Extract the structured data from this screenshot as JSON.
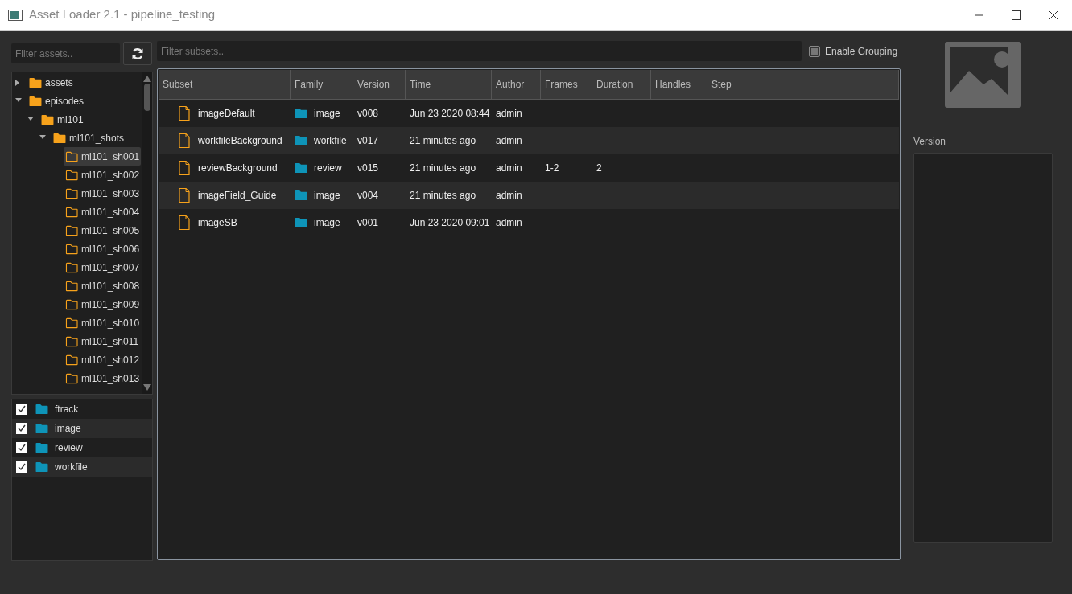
{
  "window": {
    "title": "Asset Loader 2.1 - pipeline_testing"
  },
  "asset_filter": {
    "placeholder": "Filter assets.."
  },
  "asset_tree": [
    {
      "label": "assets",
      "kind": "group",
      "expanded": false,
      "selected": false
    },
    {
      "label": "episodes",
      "kind": "group",
      "expanded": true,
      "selected": false,
      "children": [
        {
          "label": "ml101",
          "kind": "group",
          "expanded": true,
          "selected": false,
          "children": [
            {
              "label": "ml101_shots",
              "kind": "group",
              "expanded": true,
              "selected": false,
              "children": [
                {
                  "label": "ml101_sh001",
                  "kind": "leaf",
                  "selected": true
                },
                {
                  "label": "ml101_sh002",
                  "kind": "leaf",
                  "selected": false
                },
                {
                  "label": "ml101_sh003",
                  "kind": "leaf",
                  "selected": false
                },
                {
                  "label": "ml101_sh004",
                  "kind": "leaf",
                  "selected": false
                },
                {
                  "label": "ml101_sh005",
                  "kind": "leaf",
                  "selected": false
                },
                {
                  "label": "ml101_sh006",
                  "kind": "leaf",
                  "selected": false
                },
                {
                  "label": "ml101_sh007",
                  "kind": "leaf",
                  "selected": false
                },
                {
                  "label": "ml101_sh008",
                  "kind": "leaf",
                  "selected": false
                },
                {
                  "label": "ml101_sh009",
                  "kind": "leaf",
                  "selected": false
                },
                {
                  "label": "ml101_sh010",
                  "kind": "leaf",
                  "selected": false
                },
                {
                  "label": "ml101_sh011",
                  "kind": "leaf",
                  "selected": false
                },
                {
                  "label": "ml101_sh012",
                  "kind": "leaf",
                  "selected": false
                },
                {
                  "label": "ml101_sh013",
                  "kind": "leaf",
                  "selected": false
                }
              ]
            }
          ]
        }
      ]
    }
  ],
  "families": [
    {
      "label": "ftrack",
      "checked": true
    },
    {
      "label": "image",
      "checked": true
    },
    {
      "label": "review",
      "checked": true
    },
    {
      "label": "workfile",
      "checked": true
    }
  ],
  "subset_filter": {
    "placeholder": "Filter subsets.."
  },
  "enable_grouping": {
    "label": "Enable Grouping",
    "checked": false
  },
  "table": {
    "columns": [
      "Subset",
      "Family",
      "Version",
      "Time",
      "Author",
      "Frames",
      "Duration",
      "Handles",
      "Step"
    ],
    "rows": [
      [
        "imageDefault",
        "image",
        "v008",
        "Jun 23 2020 08:44",
        "admin",
        "",
        "",
        "",
        ""
      ],
      [
        "workfileBackground",
        "workfile",
        "v017",
        "21 minutes ago",
        "admin",
        "",
        "",
        "",
        ""
      ],
      [
        "reviewBackground",
        "review",
        "v015",
        "21 minutes ago",
        "admin",
        "1-2",
        "2",
        "",
        ""
      ],
      [
        "imageField_Guide",
        "image",
        "v004",
        "21 minutes ago",
        "admin",
        "",
        "",
        "",
        ""
      ],
      [
        "imageSB",
        "image",
        "v001",
        "Jun 23 2020 09:01",
        "admin",
        "",
        "",
        "",
        ""
      ]
    ]
  },
  "version_panel": {
    "label": "Version"
  }
}
